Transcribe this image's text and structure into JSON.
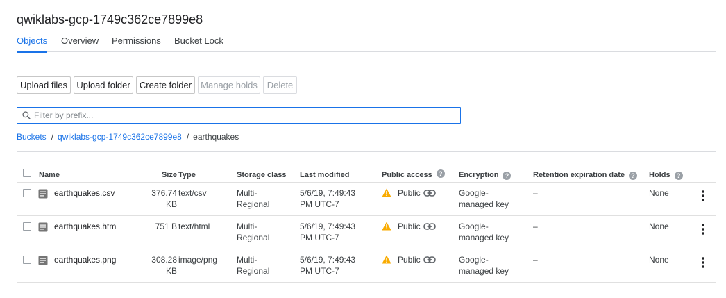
{
  "bucket_title": "qwiklabs-gcp-1749c362ce7899e8",
  "tabs": [
    {
      "label": "Objects",
      "active": true
    },
    {
      "label": "Overview",
      "active": false
    },
    {
      "label": "Permissions",
      "active": false
    },
    {
      "label": "Bucket Lock",
      "active": false
    }
  ],
  "toolbar": {
    "upload_files": "Upload files",
    "upload_folder": "Upload folder",
    "create_folder": "Create folder",
    "manage_holds": "Manage holds",
    "delete": "Delete"
  },
  "filter": {
    "placeholder": "Filter by prefix..."
  },
  "breadcrumb": {
    "root": "Buckets",
    "bucket": "qwiklabs-gcp-1749c362ce7899e8",
    "folder": "earthquakes",
    "separator": "/"
  },
  "table": {
    "headers": {
      "name": "Name",
      "size": "Size",
      "type": "Type",
      "storage_class": "Storage class",
      "last_modified": "Last modified",
      "public_access": "Public access",
      "encryption": "Encryption",
      "retention": "Retention expiration date",
      "holds": "Holds"
    },
    "help_glyph": "?",
    "rows": [
      {
        "name": "earthquakes.csv",
        "size": [
          "376.74",
          "KB"
        ],
        "type": "text/csv",
        "storage_class": [
          "Multi-",
          "Regional"
        ],
        "last_modified": [
          "5/6/19, 7:49:43",
          "PM UTC-7"
        ],
        "public_access": "Public",
        "encryption": [
          "Google-",
          "managed key"
        ],
        "retention": "–",
        "holds": "None"
      },
      {
        "name": "earthquakes.htm",
        "size": [
          "751 B",
          ""
        ],
        "type": "text/html",
        "storage_class": [
          "Multi-",
          "Regional"
        ],
        "last_modified": [
          "5/6/19, 7:49:43",
          "PM UTC-7"
        ],
        "public_access": "Public",
        "encryption": [
          "Google-",
          "managed key"
        ],
        "retention": "–",
        "holds": "None"
      },
      {
        "name": "earthquakes.png",
        "size": [
          "308.28",
          "KB"
        ],
        "type": "image/png",
        "storage_class": [
          "Multi-",
          "Regional"
        ],
        "last_modified": [
          "5/6/19, 7:49:43",
          "PM UTC-7"
        ],
        "public_access": "Public",
        "encryption": [
          "Google-",
          "managed key"
        ],
        "retention": "–",
        "holds": "None"
      }
    ]
  },
  "icons": {
    "search": "search-icon",
    "file": "file-icon",
    "warning": "warning-icon",
    "link": "link-icon",
    "more": "more-vert-icon",
    "help": "help-icon"
  },
  "colors": {
    "accent": "#1a73e8",
    "warning": "#f9ab00"
  }
}
